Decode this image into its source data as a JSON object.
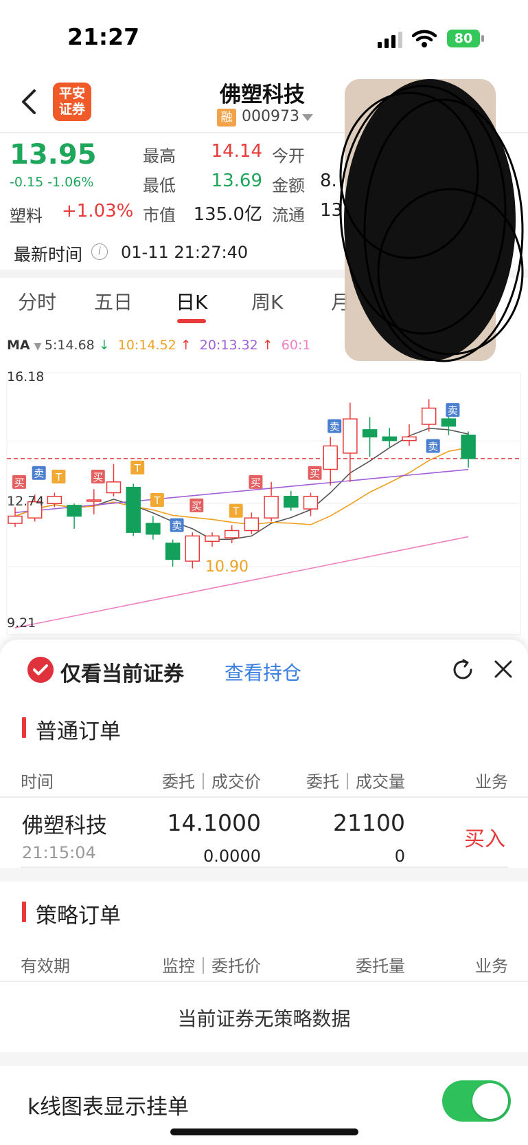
{
  "status_bar": {
    "time": "21:27",
    "battery": "80"
  },
  "header": {
    "broker_logo": "平安\n证券",
    "stock_name": "佛塑科技",
    "margin_badge": "融",
    "stock_code": "000973"
  },
  "quote": {
    "price": "13.95",
    "change": "-0.15 -1.06%",
    "sector_name": "塑料",
    "sector_change": "+1.03%",
    "high_label": "最高",
    "high_value": "14.14",
    "low_label": "最低",
    "low_value": "13.69",
    "mktcap_label": "市值",
    "mktcap_value": "135.0亿",
    "open_label": "今开",
    "amount_label": "金额",
    "amount_value": "8.",
    "float_label": "流通",
    "float_value": "13",
    "time_label": "最新时间",
    "time_value": "01-11 21:27:40"
  },
  "tabs": [
    {
      "label": "分时"
    },
    {
      "label": "五日"
    },
    {
      "label": "日K"
    },
    {
      "label": "周K"
    },
    {
      "label": "月"
    }
  ],
  "ma_row": {
    "name": "MA",
    "ma5": "5:14.68",
    "ma10": "10:14.52",
    "ma20": "20:13.32",
    "ma60": "60:1"
  },
  "chart_data": {
    "type": "candlestick",
    "y_axis_labels": [
      "16.18",
      "12.74",
      "9.21"
    ],
    "low_annotation": "10.90",
    "markers": [
      "买",
      "卖",
      "T"
    ],
    "colors": {
      "up": "#e83a3a",
      "down": "#12a05a",
      "ma5": "#555555",
      "ma10": "#f0a020",
      "ma20": "#a060d8",
      "ma60": "#f080c0"
    },
    "candles": [
      {
        "o": 12.15,
        "c": 12.35,
        "h": 12.6,
        "l": 12.05
      },
      {
        "o": 12.3,
        "c": 12.75,
        "h": 12.95,
        "l": 12.2
      },
      {
        "o": 12.7,
        "c": 12.9,
        "h": 13.0,
        "l": 12.6
      },
      {
        "o": 12.65,
        "c": 12.35,
        "h": 12.7,
        "l": 12.0
      },
      {
        "o": 12.8,
        "c": 12.8,
        "h": 13.1,
        "l": 12.4
      },
      {
        "o": 13.0,
        "c": 13.3,
        "h": 13.8,
        "l": 12.9
      },
      {
        "o": 13.15,
        "c": 11.9,
        "h": 13.25,
        "l": 11.8
      },
      {
        "o": 12.15,
        "c": 11.85,
        "h": 12.35,
        "l": 11.7
      },
      {
        "o": 11.6,
        "c": 11.15,
        "h": 11.7,
        "l": 10.95
      },
      {
        "o": 11.1,
        "c": 11.8,
        "h": 11.9,
        "l": 10.9
      },
      {
        "o": 11.65,
        "c": 11.8,
        "h": 11.9,
        "l": 11.5
      },
      {
        "o": 11.75,
        "c": 11.95,
        "h": 12.1,
        "l": 11.6
      },
      {
        "o": 11.95,
        "c": 12.3,
        "h": 12.45,
        "l": 11.85
      },
      {
        "o": 12.3,
        "c": 12.9,
        "h": 13.3,
        "l": 12.2
      },
      {
        "o": 12.9,
        "c": 12.6,
        "h": 13.05,
        "l": 12.5
      },
      {
        "o": 12.55,
        "c": 12.9,
        "h": 13.0,
        "l": 12.35
      },
      {
        "o": 13.65,
        "c": 14.3,
        "h": 14.55,
        "l": 13.2
      },
      {
        "o": 14.1,
        "c": 15.05,
        "h": 15.5,
        "l": 13.3
      },
      {
        "o": 14.75,
        "c": 14.55,
        "h": 15.1,
        "l": 14.0
      },
      {
        "o": 14.55,
        "c": 14.45,
        "h": 14.8,
        "l": 14.25
      },
      {
        "o": 14.45,
        "c": 14.55,
        "h": 14.9,
        "l": 14.3
      },
      {
        "o": 14.9,
        "c": 15.35,
        "h": 15.6,
        "l": 14.7
      },
      {
        "o": 15.05,
        "c": 14.85,
        "h": 15.2,
        "l": 14.6
      },
      {
        "o": 14.6,
        "c": 13.95,
        "h": 14.7,
        "l": 13.7
      }
    ]
  },
  "sheet": {
    "only_current": "仅看当前证券",
    "view_holdings": "查看持仓",
    "normal_orders": {
      "title": "普通订单",
      "col_time": "时间",
      "col_price": "委托｜成交价",
      "col_qty": "委托｜成交量",
      "col_biz": "业务",
      "rows": [
        {
          "name": "佛塑科技",
          "time": "21:15:04",
          "price": "14.1000",
          "fill_price": "0.0000",
          "qty": "21100",
          "fill_qty": "0",
          "side": "买入"
        }
      ]
    },
    "strategy_orders": {
      "title": "策略订单",
      "col_valid": "有效期",
      "col_monitor": "监控｜委托价",
      "col_qty": "委托量",
      "col_biz": "业务",
      "empty": "当前证券无策略数据"
    },
    "kline_toggle_label": "k线图表显示挂单"
  }
}
